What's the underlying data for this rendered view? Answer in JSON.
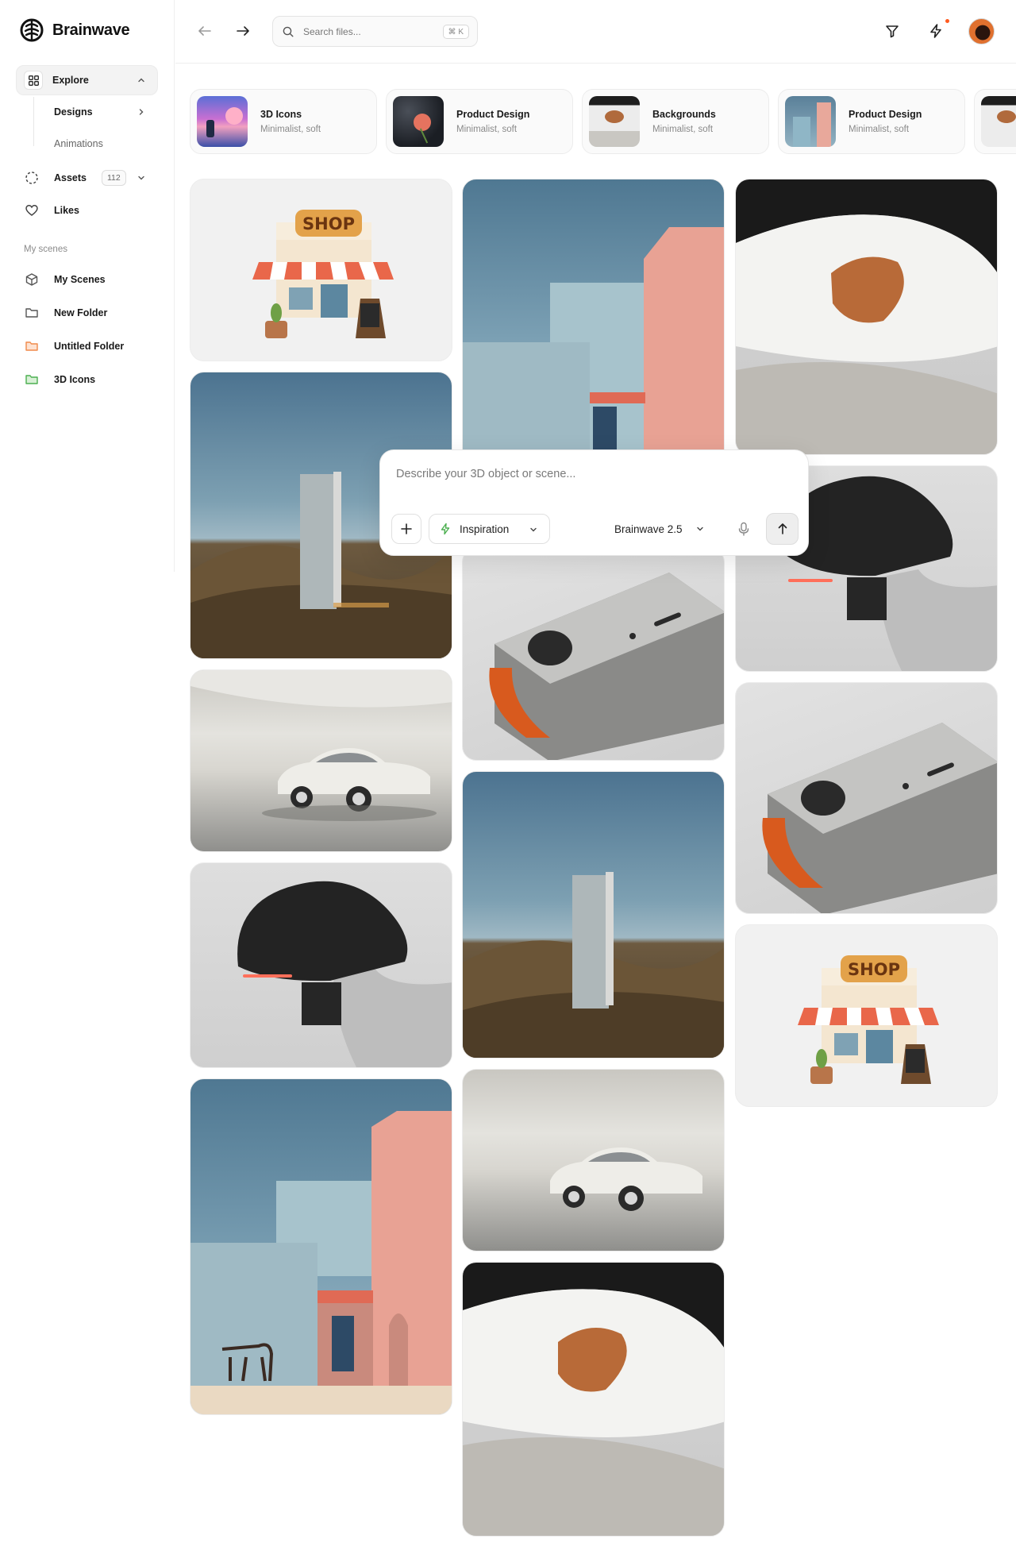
{
  "app": {
    "name": "Brainwave"
  },
  "sidebar": {
    "explore_label": "Explore",
    "sub_items": [
      "Designs",
      "Animations"
    ],
    "assets_label": "Assets",
    "assets_count": "112",
    "likes_label": "Likes",
    "section_label": "My scenes",
    "scenes": [
      {
        "label": "My Scenes",
        "icon": "cube-icon"
      },
      {
        "label": "New Folder",
        "icon": "folder-icon"
      },
      {
        "label": "Untitled Folder",
        "icon": "folder-orange-icon",
        "color": "#f08a4b"
      },
      {
        "label": "3D Icons",
        "icon": "folder-green-icon",
        "color": "#4caf50"
      }
    ]
  },
  "topbar": {
    "search_placeholder": "Search files...",
    "search_shortcut": "⌘ K"
  },
  "chips": [
    {
      "title": "3D Icons",
      "subtitle": "Minimalist, soft"
    },
    {
      "title": "Product Design",
      "subtitle": "Minimalist, soft"
    },
    {
      "title": "Backgrounds",
      "subtitle": "Minimalist, soft"
    },
    {
      "title": "Product Design",
      "subtitle": "Minimalist, soft"
    }
  ],
  "prompt": {
    "placeholder": "Describe your 3D object or scene...",
    "inspiration_label": "Inspiration",
    "model_label": "Brainwave 2.5"
  },
  "colors": {
    "accent": "#ff5a1f",
    "bolt": "#4caf50"
  }
}
